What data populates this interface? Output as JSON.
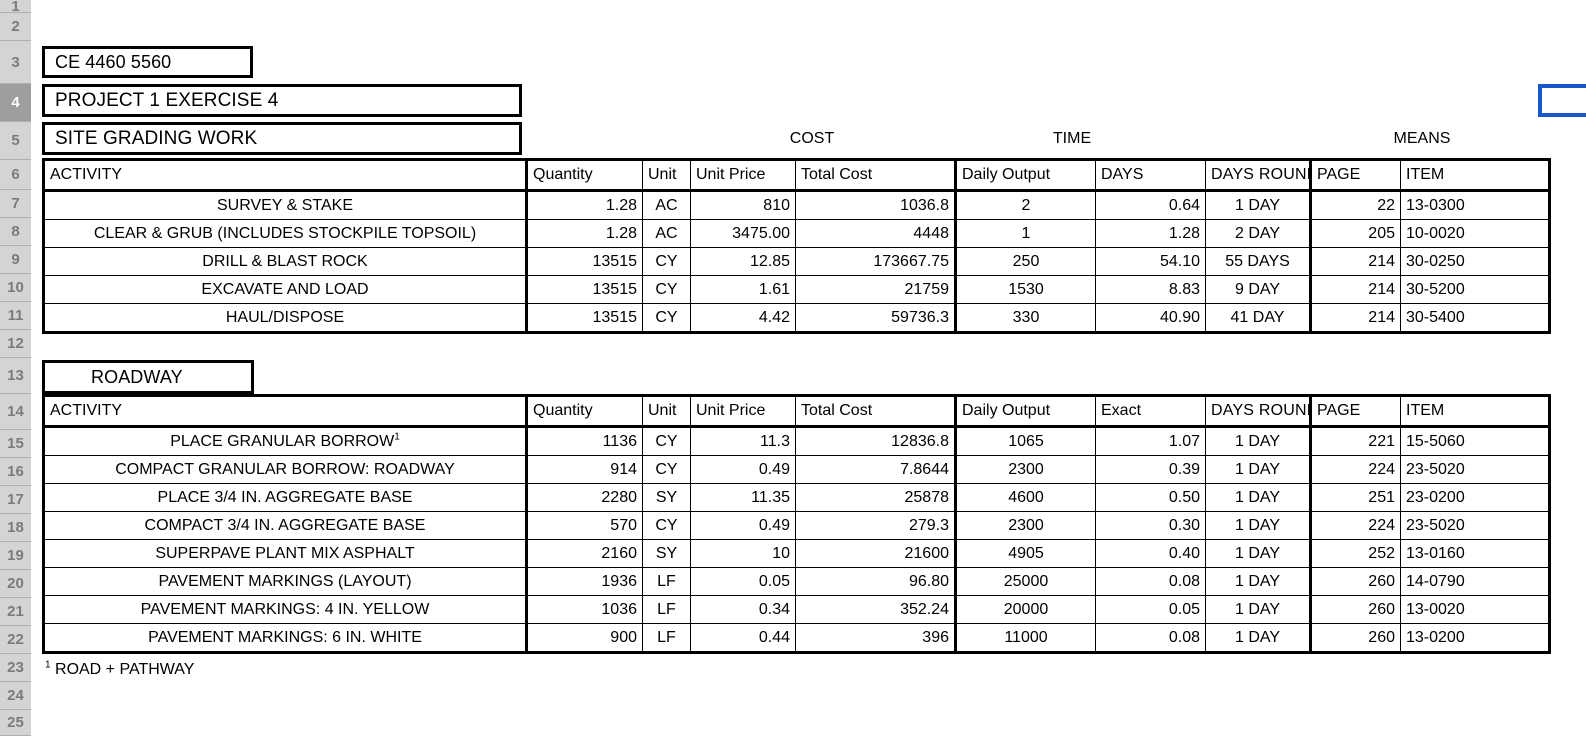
{
  "app": {
    "type": "spreadsheet",
    "selected_row": 4,
    "selection_color": "#1658c8",
    "gutter_color": "#d4d4d4",
    "gutter_selected_color": "#9e9e9e"
  },
  "row_headers": [
    "1",
    "2",
    "3",
    "4",
    "5",
    "6",
    "7",
    "8",
    "9",
    "10",
    "11",
    "12",
    "13",
    "14",
    "15",
    "16",
    "17",
    "18",
    "19",
    "20",
    "21",
    "22",
    "23",
    "24",
    "25"
  ],
  "titles": {
    "course": "CE 4460 5560",
    "project": "PROJECT 1 EXERCISE 4",
    "section_1": "SITE GRADING WORK",
    "section_2": "ROADWAY"
  },
  "group_headers": {
    "cost": "COST",
    "time": "TIME",
    "means": "MEANS"
  },
  "table1": {
    "columns": [
      "ACTIVITY",
      "Quantity",
      "Unit",
      "Unit Price",
      "Total Cost",
      "Daily Output",
      "DAYS",
      "DAYS ROUND",
      "PAGE",
      "ITEM"
    ],
    "rows": [
      {
        "activity": "SURVEY & STAKE",
        "quantity": "1.28",
        "unit": "AC",
        "unit_price": "810",
        "total_cost": "1036.8",
        "daily_output": "2",
        "days": "0.64",
        "days_round": "1 DAY",
        "page": "22",
        "item": "13-0300"
      },
      {
        "activity": "CLEAR & GRUB (INCLUDES STOCKPILE TOPSOIL)",
        "quantity": "1.28",
        "unit": "AC",
        "unit_price": "3475.00",
        "total_cost": "4448",
        "daily_output": "1",
        "days": "1.28",
        "days_round": "2 DAY",
        "page": "205",
        "item": "10-0020"
      },
      {
        "activity": "DRILL & BLAST ROCK",
        "quantity": "13515",
        "unit": "CY",
        "unit_price": "12.85",
        "total_cost": "173667.75",
        "daily_output": "250",
        "days": "54.10",
        "days_round": "55 DAYS",
        "page": "214",
        "item": "30-0250"
      },
      {
        "activity": "EXCAVATE AND LOAD",
        "quantity": "13515",
        "unit": "CY",
        "unit_price": "1.61",
        "total_cost": "21759",
        "daily_output": "1530",
        "days": "8.83",
        "days_round": "9 DAY",
        "page": "214",
        "item": "30-5200"
      },
      {
        "activity": "HAUL/DISPOSE",
        "quantity": "13515",
        "unit": "CY",
        "unit_price": "4.42",
        "total_cost": "59736.3",
        "daily_output": "330",
        "days": "40.90",
        "days_round": "41 DAY",
        "page": "214",
        "item": "30-5400"
      }
    ]
  },
  "table2": {
    "columns": [
      "ACTIVITY",
      "Quantity",
      "Unit",
      "Unit Price",
      "Total Cost",
      "Daily Output",
      "Exact",
      "DAYS ROUND",
      "PAGE",
      "ITEM"
    ],
    "rows": [
      {
        "activity": "PLACE GRANULAR BORROW",
        "activity_footnote": "1",
        "quantity": "1136",
        "unit": "CY",
        "unit_price": "11.3",
        "total_cost": "12836.8",
        "daily_output": "1065",
        "exact": "1.07",
        "days_round": "1 DAY",
        "page": "221",
        "item": "15-5060"
      },
      {
        "activity": "COMPACT GRANULAR BORROW: ROADWAY",
        "activity_footnote": "",
        "quantity": "914",
        "unit": "CY",
        "unit_price": "0.49",
        "total_cost": "7.8644",
        "daily_output": "2300",
        "exact": "0.39",
        "days_round": "1 DAY",
        "page": "224",
        "item": "23-5020"
      },
      {
        "activity": "PLACE 3/4 IN. AGGREGATE BASE",
        "activity_footnote": "",
        "quantity": "2280",
        "unit": "SY",
        "unit_price": "11.35",
        "total_cost": "25878",
        "daily_output": "4600",
        "exact": "0.50",
        "days_round": "1 DAY",
        "page": "251",
        "item": "23-0200"
      },
      {
        "activity": "COMPACT 3/4 IN. AGGREGATE BASE",
        "activity_footnote": "",
        "quantity": "570",
        "unit": "CY",
        "unit_price": "0.49",
        "total_cost": "279.3",
        "daily_output": "2300",
        "exact": "0.30",
        "days_round": "1 DAY",
        "page": "224",
        "item": "23-5020"
      },
      {
        "activity": "SUPERPAVE PLANT MIX ASPHALT",
        "activity_footnote": "",
        "quantity": "2160",
        "unit": "SY",
        "unit_price": "10",
        "total_cost": "21600",
        "daily_output": "4905",
        "exact": "0.40",
        "days_round": "1 DAY",
        "page": "252",
        "item": "13-0160"
      },
      {
        "activity": "PAVEMENT MARKINGS (LAYOUT)",
        "activity_footnote": "",
        "quantity": "1936",
        "unit": "LF",
        "unit_price": "0.05",
        "total_cost": "96.80",
        "daily_output": "25000",
        "exact": "0.08",
        "days_round": "1 DAY",
        "page": "260",
        "item": "14-0790"
      },
      {
        "activity": "PAVEMENT MARKINGS: 4 IN. YELLOW",
        "activity_footnote": "",
        "quantity": "1036",
        "unit": "LF",
        "unit_price": "0.34",
        "total_cost": "352.24",
        "daily_output": "20000",
        "exact": "0.05",
        "days_round": "1 DAY",
        "page": "260",
        "item": "13-0020"
      },
      {
        "activity": "PAVEMENT MARKINGS: 6 IN. WHITE",
        "activity_footnote": "",
        "quantity": "900",
        "unit": "LF",
        "unit_price": "0.44",
        "total_cost": "396",
        "daily_output": "11000",
        "exact": "0.08",
        "days_round": "1 DAY",
        "page": "260",
        "item": "13-0200"
      }
    ]
  },
  "footnote": {
    "marker": "1",
    "text": " ROAD + PATHWAY"
  }
}
